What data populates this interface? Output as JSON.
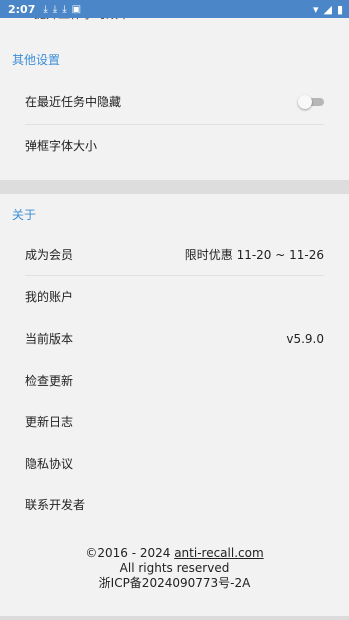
{
  "status": {
    "time": "2:07",
    "notif_icons": [
      "download-icon",
      "download-icon",
      "download-icon",
      "image-icon"
    ],
    "right_icons": [
      "wifi-icon",
      "signal-icon",
      "battery-icon"
    ]
  },
  "partial_text": "提升工作学习效率",
  "other_settings": {
    "title": "其他设置",
    "items": [
      {
        "label": "在最近任务中隐藏",
        "toggle_on": false
      },
      {
        "label": "弹框字体大小"
      }
    ]
  },
  "about": {
    "title": "关于",
    "items": [
      {
        "label": "成为会员",
        "value": "限时优惠 11-20 ~ 11-26"
      },
      {
        "label": "我的账户"
      },
      {
        "label": "当前版本",
        "value": "v5.9.0"
      },
      {
        "label": "检查更新"
      },
      {
        "label": "更新日志"
      },
      {
        "label": "隐私协议"
      },
      {
        "label": "联系开发者"
      }
    ]
  },
  "footer": {
    "copyright_prefix": "©2016 - 2024 ",
    "link": "anti-recall.com",
    "rights": "All rights reserved",
    "icp": "浙ICP备2024090773号-2A"
  }
}
